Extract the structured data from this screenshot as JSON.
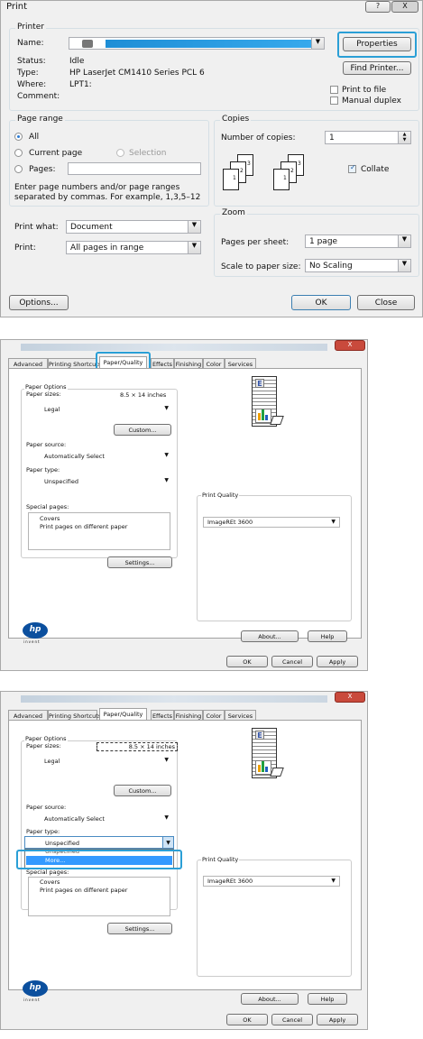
{
  "print_dialog": {
    "title": "Print",
    "help": "?",
    "close": "X",
    "printer_group": "Printer",
    "name_label": "Name:",
    "properties": "Properties",
    "find_printer": "Find Printer...",
    "status_label": "Status:",
    "status": "Idle",
    "type_label": "Type:",
    "type": "HP LaserJet CM1410 Series PCL 6",
    "where_label": "Where:",
    "where": "LPT1:",
    "comment_label": "Comment:",
    "print_to_file": "Print to file",
    "manual_duplex": "Manual duplex",
    "page_range": "Page range",
    "all": "All",
    "current_page": "Current page",
    "selection": "Selection",
    "pages": "Pages:",
    "hint_line1": "Enter page numbers and/or page ranges",
    "hint_line2": "separated by commas.  For example, 1,3,5–12",
    "copies": "Copies",
    "number_of_copies": "Number of copies:",
    "copies_value": "1",
    "collate": "Collate",
    "print_what_label": "Print what:",
    "print_what": "Document",
    "print_label": "Print:",
    "print": "All pages in range",
    "zoom": "Zoom",
    "pages_per_sheet_label": "Pages per sheet:",
    "pages_per_sheet": "1 page",
    "scale_label": "Scale to paper size:",
    "scale": "No Scaling",
    "options": "Options...",
    "ok": "OK",
    "close_btn": "Close",
    "collate_stack1": [
      "3",
      "2",
      "1"
    ],
    "collate_stack2": [
      "3",
      "2",
      "1"
    ]
  },
  "props1": {
    "tabs": [
      "Advanced",
      "Printing Shortcuts",
      "Paper/Quality",
      "Effects",
      "Finishing",
      "Color",
      "Services"
    ],
    "paper_options": "Paper Options",
    "paper_sizes": "Paper sizes:",
    "paper_size_value": "8.5 × 14 inches",
    "size": "Legal",
    "custom": "Custom...",
    "paper_source": "Paper source:",
    "source": "Automatically Select",
    "paper_type": "Paper type:",
    "type": "Unspecified",
    "special_pages": "Special pages:",
    "covers": "Covers",
    "print_pages": "Print pages on different paper",
    "settings": "Settings...",
    "print_quality": "Print Quality",
    "quality": "ImageREt 3600",
    "logo": "hp",
    "logo_sub": "invent",
    "about": "About...",
    "help": "Help",
    "ok": "OK",
    "cancel": "Cancel",
    "apply": "Apply",
    "close": "X"
  },
  "props2": {
    "tabs": [
      "Advanced",
      "Printing Shortcuts",
      "Paper/Quality",
      "Effects",
      "Finishing",
      "Color",
      "Services"
    ],
    "paper_options": "Paper Options",
    "paper_sizes": "Paper sizes:",
    "paper_size_value": "8.5 × 14 inches",
    "size": "Legal",
    "custom": "Custom...",
    "paper_source": "Paper source:",
    "source": "Automatically Select",
    "paper_type": "Paper type:",
    "type": "Unspecified",
    "list_partial": "Unspecified",
    "list_more": "More...",
    "special_pages": "Special pages:",
    "covers": "Covers",
    "print_pages": "Print pages on different paper",
    "settings": "Settings...",
    "print_quality": "Print Quality",
    "quality": "ImageREt 3600",
    "logo": "hp",
    "logo_sub": "invent",
    "about": "About...",
    "help": "Help",
    "ok": "OK",
    "cancel": "Cancel",
    "apply": "Apply",
    "close": "X"
  },
  "colors": {
    "accent": "#2a9fd6",
    "selection": "#3399ff",
    "close_red": "#c94a3c"
  }
}
